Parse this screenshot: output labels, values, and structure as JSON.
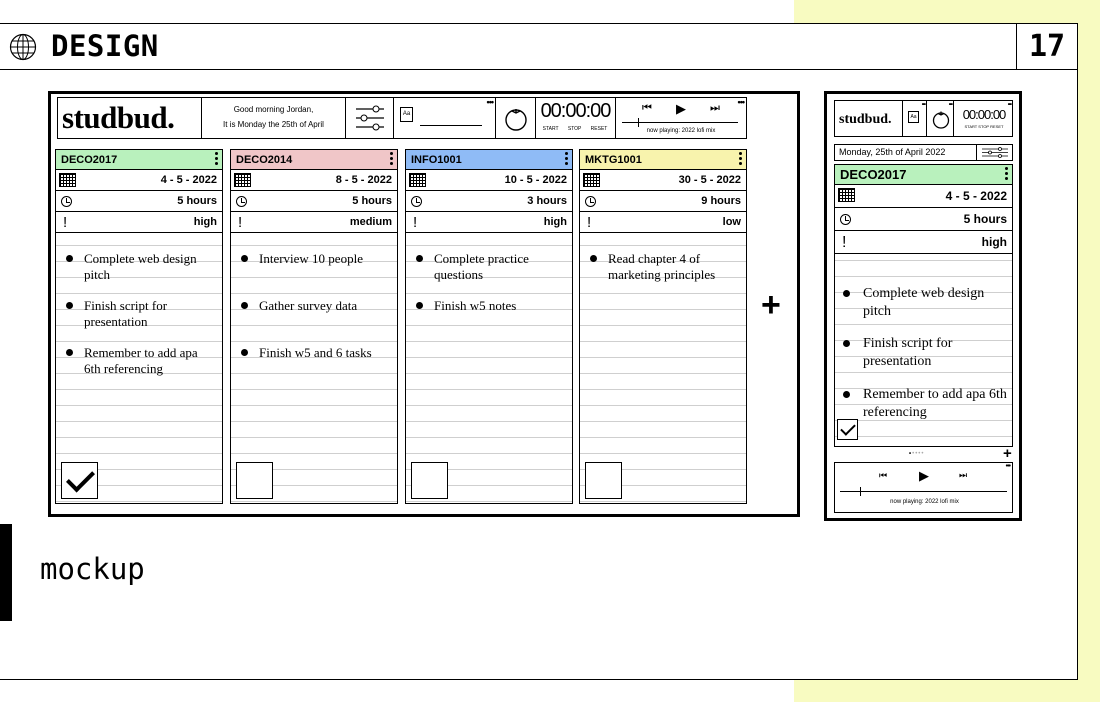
{
  "header": {
    "title": "DESIGN",
    "page_number": "17",
    "globe_icon": "globe-icon"
  },
  "section_label": "mockup",
  "colors": {
    "deco2017": "#b9f1bd",
    "deco2014": "#f0c6c8",
    "info1001": "#8fbbf6",
    "mktg1001": "#f8f3ad",
    "page_accent": "#f8fbc1"
  },
  "desktop": {
    "logo": "studbud.",
    "greeting_line1": "Good morning Jordan,",
    "greeting_line2": "It is Monday the 25th of April",
    "font_control": {
      "icon": "Aa"
    },
    "timer": {
      "time": "00:00:00",
      "start": "START",
      "stop": "STOP",
      "reset": "RESET"
    },
    "music": {
      "now_playing": "now playing: 2022 lofi mix"
    },
    "cards": [
      {
        "code": "DECO2017",
        "date": "4 - 5 - 2022",
        "hours": "5 hours",
        "priority": "high",
        "tasks": [
          "Complete web design pitch",
          "Finish script for presentation",
          "Remember to add apa 6th referencing"
        ],
        "checked": true
      },
      {
        "code": "DECO2014",
        "date": "8 - 5 - 2022",
        "hours": "5 hours",
        "priority": "medium",
        "tasks": [
          "Interview 10 people",
          "Gather survey data",
          "Finish w5 and 6 tasks"
        ],
        "checked": false
      },
      {
        "code": "INFO1001",
        "date": "10 - 5 - 2022",
        "hours": "3 hours",
        "priority": "high",
        "tasks": [
          "Complete practice questions",
          "Finish w5 notes"
        ],
        "checked": false
      },
      {
        "code": "MKTG1001",
        "date": "30 - 5 - 2022",
        "hours": "9 hours",
        "priority": "low",
        "tasks": [
          "Read chapter 4 of marketing principles"
        ],
        "checked": false
      }
    ],
    "add_button": "+"
  },
  "mobile": {
    "logo": "studbud.",
    "font_icon": "Aa",
    "timer": {
      "time": "00:00:00",
      "controls": "START STOP RESET"
    },
    "date_label": "Monday, 25th of April 2022",
    "card": {
      "code": "DECO2017",
      "date": "4 - 5 - 2022",
      "hours": "5 hours",
      "priority": "high",
      "tasks": [
        "Complete web design pitch",
        "Finish script for presentation",
        "Remember to add apa 6th referencing"
      ],
      "checked": true
    },
    "add_button": "+",
    "now_playing": "now playing: 2022 lofi mix"
  }
}
